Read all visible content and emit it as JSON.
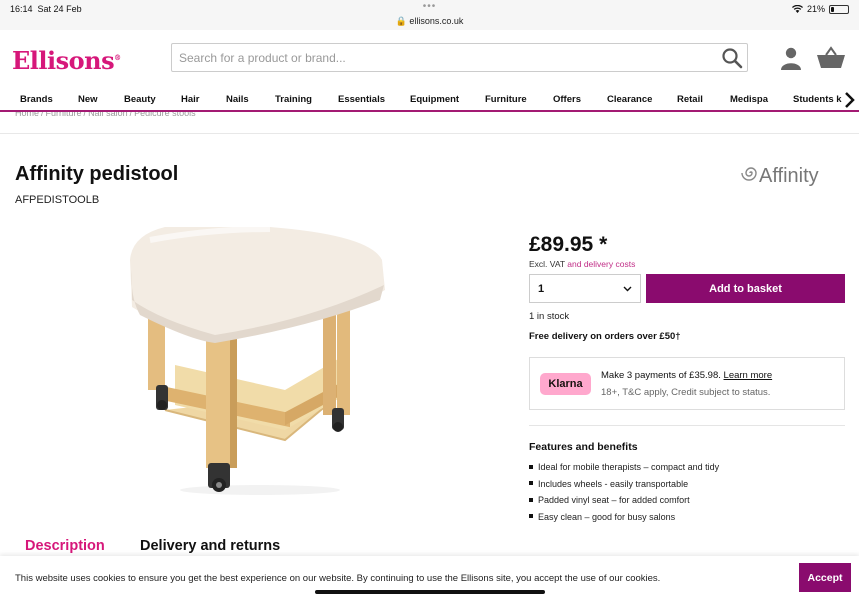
{
  "status_bar": {
    "time": "16:14",
    "date": "Sat 24 Feb",
    "dots": "•••",
    "url": "ellisons.co.uk",
    "battery": "21%",
    "battery_level": 0.21
  },
  "header": {
    "logo": "Ellisons",
    "logo_mark": "®",
    "search_placeholder": "Search for a product or brand...",
    "icons": [
      "search-icon",
      "account-icon",
      "basket-icon"
    ]
  },
  "nav": {
    "items": [
      "Brands",
      "New",
      "Beauty",
      "Hair",
      "Nails",
      "Training",
      "Essentials",
      "Equipment",
      "Furniture",
      "Offers",
      "Clearance",
      "Retail",
      "Medispa",
      "Students k"
    ],
    "arrow_icon": "chevron-right-icon"
  },
  "breadcrumb": [
    "Home",
    "/",
    "Furniture",
    "/",
    "Nail salon",
    "/",
    "Pedicure stools"
  ],
  "product": {
    "title": "Affinity pedistool",
    "sku": "AFPEDISTOOLB",
    "brand": "Affinity",
    "price": "£89.95 *",
    "vat_text": "Excl. VAT",
    "vat_link": "and delivery costs",
    "quantity": "1",
    "add_button": "Add to basket",
    "stock": "1 in stock",
    "free_delivery": "Free delivery on orders over £50†"
  },
  "klarna": {
    "badge": "Klarna",
    "line1": "Make 3 payments of £35.98.",
    "learn_more": "Learn more",
    "line2": "18+, T&C apply, Credit subject to status."
  },
  "features": {
    "heading": "Features and benefits",
    "items": [
      "Ideal for mobile therapists – compact and tidy",
      "Includes wheels - easily transportable",
      "Padded vinyl seat – for added comfort",
      "Easy clean – good for busy salons"
    ]
  },
  "tabs": {
    "description": "Description",
    "delivery": "Delivery and returns"
  },
  "cookie": {
    "text": "This website uses cookies to ensure you get the best experience on our website. By continuing to use the Ellisons site, you accept the use of our cookies.",
    "accept": "Accept"
  },
  "colors": {
    "brand": "#d6177a",
    "button": "#8a0b6e",
    "klarna": "#ffa8cd",
    "nav_underline": "#a31a73"
  }
}
